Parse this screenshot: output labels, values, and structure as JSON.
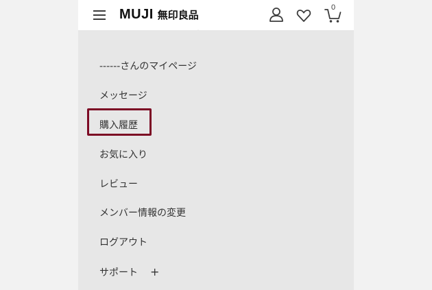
{
  "header": {
    "logo_en": "MUJI",
    "logo_jp": "無印良品",
    "cart_count": "0",
    "icons": [
      "menu-icon",
      "account-icon",
      "heart-icon",
      "cart-icon"
    ]
  },
  "menu": {
    "items": [
      {
        "label": "------さんのマイページ"
      },
      {
        "label": "メッセージ"
      },
      {
        "label": "購入履歴"
      },
      {
        "label": "お気に入り"
      },
      {
        "label": "レビュー"
      },
      {
        "label": "メンバー情報の変更"
      },
      {
        "label": "ログアウト"
      },
      {
        "label": "サポート"
      }
    ],
    "support_expand": "+",
    "highlighted_item": "購入履歴"
  },
  "colors": {
    "page_background": "#f2f2f2",
    "panel_background": "#e7e7e7",
    "header_background": "#ffffff",
    "highlight_border": "#7c0a24"
  }
}
